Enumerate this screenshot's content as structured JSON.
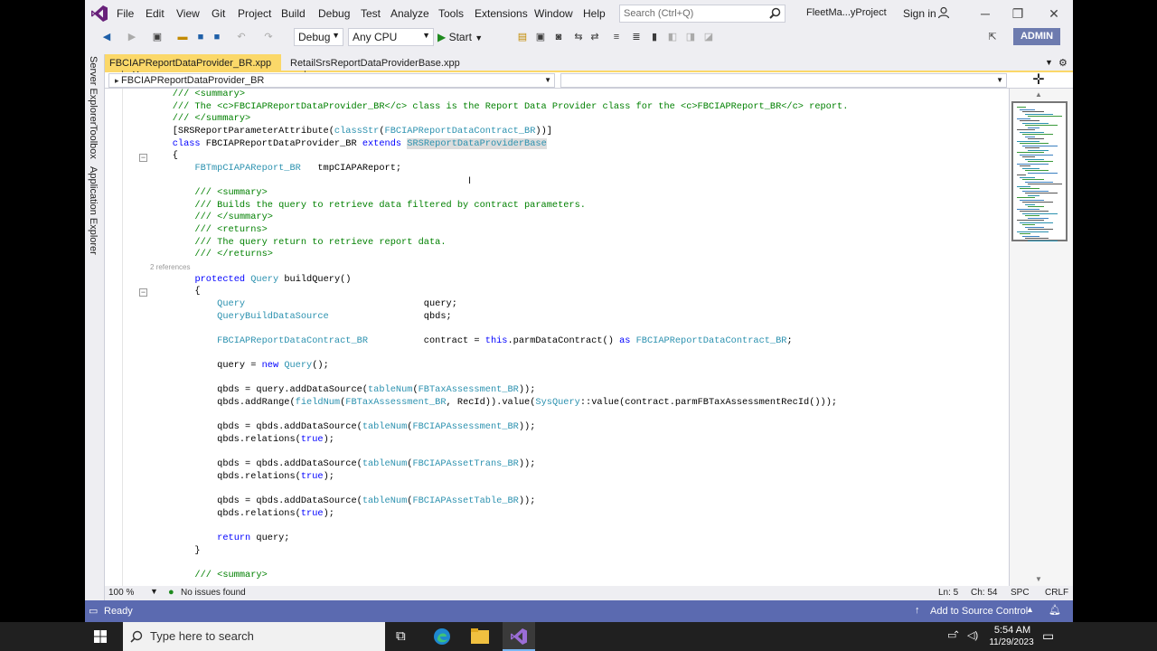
{
  "title_bar": {
    "menu": [
      "File",
      "Edit",
      "View",
      "Git",
      "Project",
      "Build",
      "Debug",
      "Test",
      "Analyze",
      "Tools",
      "Extensions",
      "Window",
      "Help"
    ],
    "search_placeholder": "Search (Ctrl+Q)",
    "project_name": "FleetMa...yProject",
    "sign_in": "Sign in"
  },
  "toolbar": {
    "config": "Debug",
    "platform": "Any CPU",
    "start": "Start",
    "admin_badge": "ADMIN"
  },
  "left_strip": [
    "Server Explorer",
    "Toolbox",
    "Application Explorer"
  ],
  "doc_tabs": [
    {
      "label": "FBCIAPReportDataProvider_BR.xpp",
      "pin": "⊣",
      "close": "✕"
    },
    {
      "label": "RetailSrsReportDataProviderBase.xpp",
      "pin": "⊣"
    }
  ],
  "nav_bar": {
    "left": "FBCIAPReportDataProvider_BR",
    "right": ""
  },
  "code_lines": [
    [
      {
        "t": "    /// <summary>",
        "c": "cm"
      }
    ],
    [
      {
        "t": "    /// The <c>FBCIAPReportDataProvider_BR</c> class is the Report Data Provider class for the <c>FBCIAPReport_BR</c> report.",
        "c": "cm"
      }
    ],
    [
      {
        "t": "    /// </summary>",
        "c": "cm"
      }
    ],
    [
      {
        "t": "    [SRSReportParameterAttribute(",
        "c": ""
      },
      {
        "t": "classStr",
        "c": "ty"
      },
      {
        "t": "(",
        "c": ""
      },
      {
        "t": "FBCIAPReportDataContract_BR",
        "c": "ty"
      },
      {
        "t": "))]",
        "c": ""
      }
    ],
    [
      {
        "t": "    ",
        "c": ""
      },
      {
        "t": "class",
        "c": "kw"
      },
      {
        "t": " FBCIAPReportDataProvider_BR ",
        "c": ""
      },
      {
        "t": "extends",
        "c": "kw"
      },
      {
        "t": " ",
        "c": ""
      },
      {
        "t": "SRSReportDataProviderBase",
        "c": "ty hl"
      }
    ],
    [
      {
        "t": "    {",
        "c": ""
      }
    ],
    [
      {
        "t": "        ",
        "c": ""
      },
      {
        "t": "FBTmpCIAPAReport_BR",
        "c": "ty"
      },
      {
        "t": "   tmpCIAPAReport;",
        "c": ""
      }
    ],
    [
      {
        "t": "",
        "c": ""
      }
    ],
    [
      {
        "t": "        /// <summary>",
        "c": "cm"
      }
    ],
    [
      {
        "t": "        /// Builds the query to retrieve data filtered by contract parameters.",
        "c": "cm"
      }
    ],
    [
      {
        "t": "        /// </summary>",
        "c": "cm"
      }
    ],
    [
      {
        "t": "        /// <returns>",
        "c": "cm"
      }
    ],
    [
      {
        "t": "        /// The query return to retrieve report data.",
        "c": "cm"
      }
    ],
    [
      {
        "t": "        /// </returns>",
        "c": "cm"
      }
    ],
    [
      {
        "t": "2 references",
        "c": "ref"
      }
    ],
    [
      {
        "t": "        ",
        "c": ""
      },
      {
        "t": "protected",
        "c": "kw"
      },
      {
        "t": " ",
        "c": ""
      },
      {
        "t": "Query",
        "c": "ty"
      },
      {
        "t": " buildQuery()",
        "c": ""
      }
    ],
    [
      {
        "t": "        {",
        "c": ""
      }
    ],
    [
      {
        "t": "            ",
        "c": ""
      },
      {
        "t": "Query",
        "c": "ty"
      },
      {
        "t": "                                query;",
        "c": ""
      }
    ],
    [
      {
        "t": "            ",
        "c": ""
      },
      {
        "t": "QueryBuildDataSource",
        "c": "ty"
      },
      {
        "t": "                 qbds;",
        "c": ""
      }
    ],
    [
      {
        "t": "",
        "c": ""
      }
    ],
    [
      {
        "t": "            ",
        "c": ""
      },
      {
        "t": "FBCIAPReportDataContract_BR",
        "c": "ty"
      },
      {
        "t": "          contract = ",
        "c": ""
      },
      {
        "t": "this",
        "c": "kw"
      },
      {
        "t": ".parmDataContract() ",
        "c": ""
      },
      {
        "t": "as",
        "c": "kw"
      },
      {
        "t": " ",
        "c": ""
      },
      {
        "t": "FBCIAPReportDataContract_BR",
        "c": "ty"
      },
      {
        "t": ";",
        "c": ""
      }
    ],
    [
      {
        "t": "",
        "c": ""
      }
    ],
    [
      {
        "t": "            query = ",
        "c": ""
      },
      {
        "t": "new",
        "c": "kw"
      },
      {
        "t": " ",
        "c": ""
      },
      {
        "t": "Query",
        "c": "ty"
      },
      {
        "t": "();",
        "c": ""
      }
    ],
    [
      {
        "t": "",
        "c": ""
      }
    ],
    [
      {
        "t": "            qbds = query.addDataSource(",
        "c": ""
      },
      {
        "t": "tableNum",
        "c": "ty"
      },
      {
        "t": "(",
        "c": ""
      },
      {
        "t": "FBTaxAssessment_BR",
        "c": "ty"
      },
      {
        "t": "));",
        "c": ""
      }
    ],
    [
      {
        "t": "            qbds.addRange(",
        "c": ""
      },
      {
        "t": "fieldNum",
        "c": "ty"
      },
      {
        "t": "(",
        "c": ""
      },
      {
        "t": "FBTaxAssessment_BR",
        "c": "ty"
      },
      {
        "t": ", RecId)).value(",
        "c": ""
      },
      {
        "t": "SysQuery",
        "c": "ty"
      },
      {
        "t": "::value(contract.parmFBTaxAssessmentRecId()));",
        "c": ""
      }
    ],
    [
      {
        "t": "",
        "c": ""
      }
    ],
    [
      {
        "t": "            qbds = qbds.addDataSource(",
        "c": ""
      },
      {
        "t": "tableNum",
        "c": "ty"
      },
      {
        "t": "(",
        "c": ""
      },
      {
        "t": "FBCIAPAssessment_BR",
        "c": "ty"
      },
      {
        "t": "));",
        "c": ""
      }
    ],
    [
      {
        "t": "            qbds.relations(",
        "c": ""
      },
      {
        "t": "true",
        "c": "kw"
      },
      {
        "t": ");",
        "c": ""
      }
    ],
    [
      {
        "t": "",
        "c": ""
      }
    ],
    [
      {
        "t": "            qbds = qbds.addDataSource(",
        "c": ""
      },
      {
        "t": "tableNum",
        "c": "ty"
      },
      {
        "t": "(",
        "c": ""
      },
      {
        "t": "FBCIAPAssetTrans_BR",
        "c": "ty"
      },
      {
        "t": "));",
        "c": ""
      }
    ],
    [
      {
        "t": "            qbds.relations(",
        "c": ""
      },
      {
        "t": "true",
        "c": "kw"
      },
      {
        "t": ");",
        "c": ""
      }
    ],
    [
      {
        "t": "",
        "c": ""
      }
    ],
    [
      {
        "t": "            qbds = qbds.addDataSource(",
        "c": ""
      },
      {
        "t": "tableNum",
        "c": "ty"
      },
      {
        "t": "(",
        "c": ""
      },
      {
        "t": "FBCIAPAssetTable_BR",
        "c": "ty"
      },
      {
        "t": "));",
        "c": ""
      }
    ],
    [
      {
        "t": "            qbds.relations(",
        "c": ""
      },
      {
        "t": "true",
        "c": "kw"
      },
      {
        "t": ");",
        "c": ""
      }
    ],
    [
      {
        "t": "",
        "c": ""
      }
    ],
    [
      {
        "t": "            ",
        "c": ""
      },
      {
        "t": "return",
        "c": "kw"
      },
      {
        "t": " query;",
        "c": ""
      }
    ],
    [
      {
        "t": "        }",
        "c": ""
      }
    ],
    [
      {
        "t": "",
        "c": ""
      }
    ],
    [
      {
        "t": "        /// <summary>",
        "c": "cm"
      }
    ]
  ],
  "editor_status": {
    "zoom": "100 %",
    "issues": "No issues found",
    "ln": "Ln: 5",
    "ch": "Ch: 54",
    "spc": "SPC",
    "eol": "CRLF"
  },
  "status_bar": {
    "ready": "Ready",
    "source_control": "Add to Source Control"
  },
  "taskbar": {
    "search_placeholder": "Type here to search",
    "time": "5:54 AM",
    "date": "11/29/2023"
  },
  "colors": {
    "status_bar": "#5b6ab0",
    "active_tab": "#fbd869",
    "comment": "#008000",
    "keyword": "#0000ff",
    "type": "#2b91af",
    "vs_purple": "#68217a"
  }
}
